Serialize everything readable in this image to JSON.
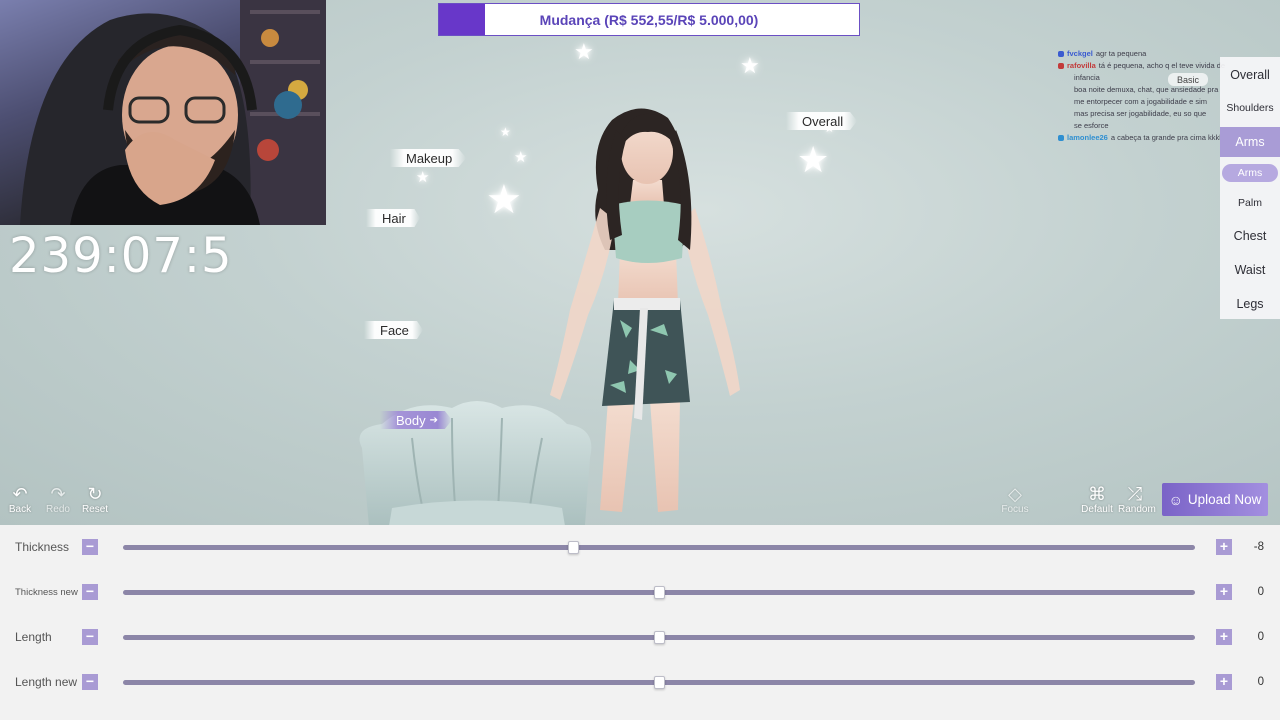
{
  "goal": {
    "text": "Mudança (R$ 552,55/R$ 5.000,00)",
    "progress": 0.1105,
    "fill_color": "#6837c9"
  },
  "stream": {
    "timer": "239:07:5"
  },
  "categories": {
    "makeup": "Makeup",
    "hair": "Hair",
    "face": "Face",
    "body": "Body",
    "overall": "Overall"
  },
  "chat": [
    {
      "user": "fvckgel",
      "message": "agr ta pequena",
      "user_color": "#3a5bd0"
    },
    {
      "user": "rafovilla",
      "message": "tá é pequena, acho q el teve vivida de",
      "user_color": "#c23a3a"
    },
    {
      "user": "",
      "message": "infancia",
      "user_color": "#333333"
    },
    {
      "user": "",
      "message": "boa noite demuxa, chat, que ansiedade pra",
      "user_color": "#9b59d0"
    },
    {
      "user": "",
      "message": "me entorpecer com a jogabilidade e sim",
      "user_color": "#333333"
    },
    {
      "user": "",
      "message": "mas precisa ser jogabilidade, eu so que",
      "user_color": "#333333"
    },
    {
      "user": "",
      "message": "se esforce",
      "user_color": "#333333"
    },
    {
      "user": "lamonlee26",
      "message": "a cabeça ta grande pra cima kkkk",
      "user_color": "#2f8fd1"
    }
  ],
  "right_menu": {
    "basic_tag": "Basic",
    "items": [
      "Overall",
      "Shoulders",
      "Arms",
      "Arms",
      "Palm",
      "Chest",
      "Waist",
      "Legs"
    ]
  },
  "tools": {
    "back": "Back",
    "redo": "Redo",
    "reset": "Reset",
    "focus": "Focus",
    "default": "Default",
    "random": "Random"
  },
  "upload": {
    "label": "Upload Now"
  },
  "sliders": [
    {
      "label": "Thickness",
      "value": "-8",
      "position": 0.42
    },
    {
      "label": "Thickness new",
      "value": "0",
      "position": 0.5
    },
    {
      "label": "Length",
      "value": "0",
      "position": 0.5
    },
    {
      "label": "Length new",
      "value": "0",
      "position": 0.5
    }
  ],
  "accent_color": "#a99bd4"
}
